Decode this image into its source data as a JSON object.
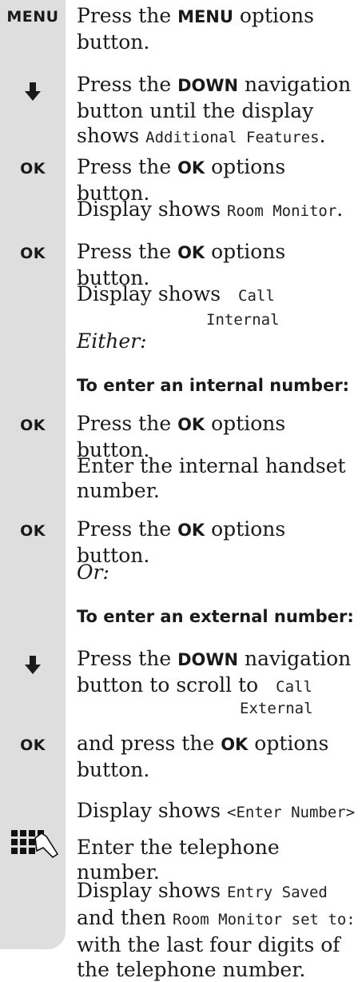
{
  "icons": {
    "menu": "MENU",
    "ok": "OK",
    "down_arrow": "down-arrow-icon",
    "keypad": "keypad-icon"
  },
  "steps": {
    "s1": {
      "pre": "Press the ",
      "key": "MENU",
      "post": " options button."
    },
    "s2": {
      "pre": "Press the ",
      "key": "DOWN",
      "post": " navigation button until the display shows ",
      "lcd": "Additional Features",
      "end": "."
    },
    "s3": {
      "pre": "Press the ",
      "key": "OK",
      "post": " options button."
    },
    "s3b": {
      "pre": "Display shows ",
      "lcd": "Room Monitor",
      "end": "."
    },
    "s4": {
      "pre": "Press the ",
      "key": "OK",
      "post": " options button."
    },
    "s4b": {
      "pre": "Display shows ",
      "lcd1": "Call",
      "lcd2": "Internal"
    },
    "either": "Either:",
    "internal_header": "To enter an internal number:",
    "s5": {
      "pre": "Press the ",
      "key": "OK",
      "post": " options button."
    },
    "s5b": "Enter the internal handset number.",
    "s6": {
      "pre": "Press the ",
      "key": "OK",
      "post": " options button."
    },
    "or": "Or:",
    "external_header": "To enter an external number:",
    "s7": {
      "pre": "Press the ",
      "key": "DOWN",
      "post": " navigation button to scroll to ",
      "lcd1": "Call",
      "lcd2": "External"
    },
    "s8": {
      "pre": "and press the ",
      "key": "OK",
      "post": " options button."
    },
    "s8b": {
      "pre": "Display shows ",
      "lcd": "<Enter Number>"
    },
    "s9": "Enter the telephone number.",
    "s10": {
      "pre": "Display shows ",
      "lcd1": "Entry Saved",
      "mid": " and then ",
      "lcd2": "Room Monitor set to:",
      "post": " with the last four digits of the telephone number."
    }
  }
}
